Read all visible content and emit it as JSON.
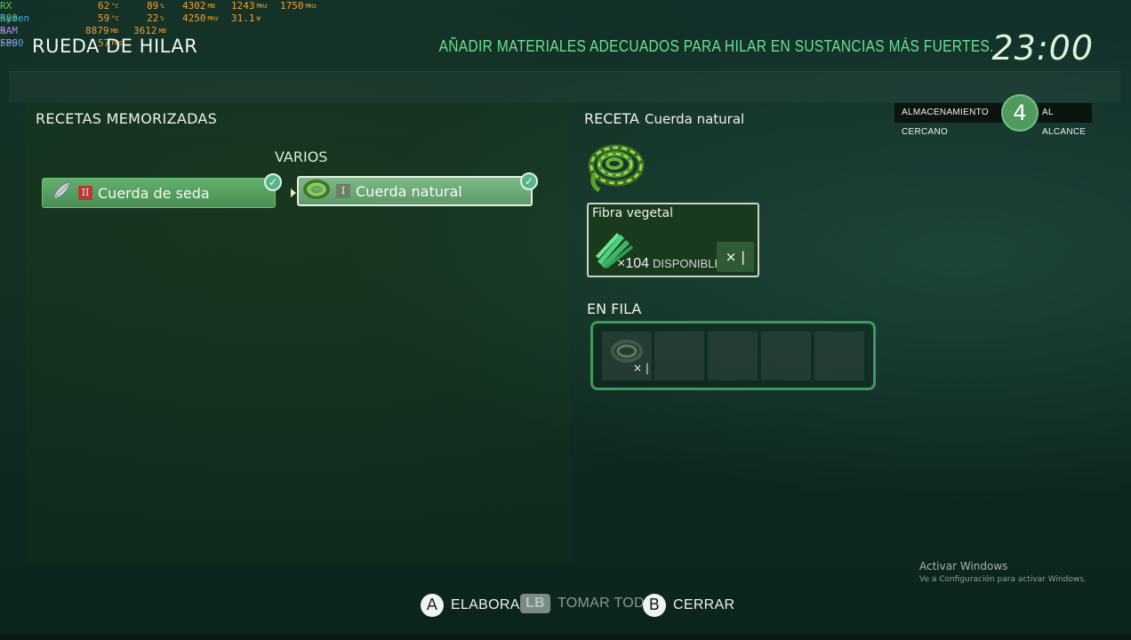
{
  "perf_overlay": {
    "rows": [
      {
        "label": "RX 580",
        "label_color": "#5fc24a",
        "values": [
          {
            "v": "62",
            "u": "°C"
          },
          {
            "v": "89",
            "u": "%"
          },
          {
            "v": "4302",
            "u": "MB"
          },
          {
            "v": "1243",
            "u": "MHz"
          },
          {
            "v": "1750",
            "u": "MHz"
          }
        ]
      },
      {
        "label": "Ryzen 5 5500",
        "label_color": "#48a6e8",
        "values": [
          {
            "v": "59",
            "u": "°C"
          },
          {
            "v": "22",
            "u": "%"
          },
          {
            "v": "4250",
            "u": "MHz"
          },
          {
            "v": "31.1",
            "u": "W"
          }
        ]
      },
      {
        "label": "RAM",
        "label_color": "#b080e0",
        "values": [
          {
            "v": "8879",
            "u": "MB"
          },
          {
            "v": "3612",
            "u": "MB"
          }
        ]
      },
      {
        "label": "FPS",
        "label_color": "#b080e0",
        "values": [
          {
            "v": "57",
            "u": "FPS"
          }
        ]
      }
    ]
  },
  "header": {
    "title": "RUEDA DE HILAR",
    "hint": "AÑADIR MATERIALES ADECUADOS PARA HILAR EN SUSTANCIAS MÁS FUERTES.",
    "clock": "23:00"
  },
  "left": {
    "section_title": "RECETAS MEMORIZADAS",
    "category": "VARIOS",
    "recipes": [
      {
        "tier": "II",
        "name": "Cuerda de seda",
        "icon": "silk-icon",
        "known": true
      },
      {
        "tier": "I",
        "name": "Cuerda natural",
        "icon": "rope-icon",
        "known": true,
        "selected": true
      }
    ]
  },
  "storage": {
    "label": "ALMACENAMIENTO CERCANO",
    "count": "4",
    "suffix": "AL ALCANCE"
  },
  "recipe": {
    "label": "RECETA",
    "name": "Cuerda natural",
    "icon": "rope-icon",
    "ingredient": {
      "name": "Fibra vegetal",
      "qty_prefix": "×",
      "qty": "104",
      "available_label": "DISPONIBLE",
      "required": "× |"
    }
  },
  "queue": {
    "title": "EN FILA",
    "slots": [
      {
        "filled": true,
        "icon": "rope-icon",
        "qty": "× |"
      },
      {
        "filled": false
      },
      {
        "filled": false
      },
      {
        "filled": false
      },
      {
        "filled": false
      }
    ]
  },
  "actions": [
    {
      "button": "A",
      "label": "ELABORAR",
      "enabled": true
    },
    {
      "button": "LB",
      "label": "TOMAR TODO",
      "enabled": false
    },
    {
      "button": "B",
      "label": "CERRAR",
      "enabled": true
    }
  ],
  "watermark": {
    "line1": "Activar Windows",
    "line2": "Ve a Configuración para activar Windows."
  },
  "colors": {
    "accent_green": "#6de08e",
    "recipe_button": "#62b06a",
    "queue_border": "#3e9a5c"
  }
}
